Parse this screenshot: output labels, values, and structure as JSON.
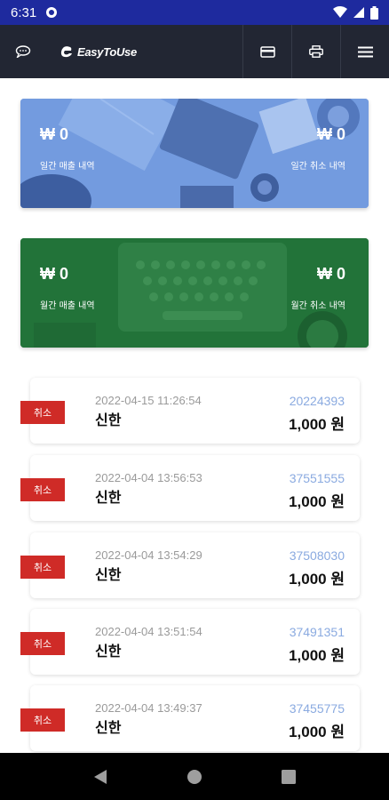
{
  "status_bar": {
    "time": "6:31"
  },
  "app_bar": {
    "brand": "EasyToUse"
  },
  "weekly_card": {
    "sales_amount": "₩ 0",
    "sales_label": "일간 매출 내역",
    "cancel_amount": "₩ 0",
    "cancel_label": "일간 취소 내역"
  },
  "monthly_card": {
    "sales_amount": "₩ 0",
    "sales_label": "월간 매출 내역",
    "cancel_amount": "₩ 0",
    "cancel_label": "월간 취소 내역"
  },
  "transactions": [
    {
      "badge": "취소",
      "datetime": "2022-04-15 11:26:54",
      "bank": "신한",
      "approval_no": "20224393",
      "amount": "1,000 원"
    },
    {
      "badge": "취소",
      "datetime": "2022-04-04 13:56:53",
      "bank": "신한",
      "approval_no": "37551555",
      "amount": "1,000 원"
    },
    {
      "badge": "취소",
      "datetime": "2022-04-04 13:54:29",
      "bank": "신한",
      "approval_no": "37508030",
      "amount": "1,000 원"
    },
    {
      "badge": "취소",
      "datetime": "2022-04-04 13:51:54",
      "bank": "신한",
      "approval_no": "37491351",
      "amount": "1,000 원"
    },
    {
      "badge": "취소",
      "datetime": "2022-04-04 13:49:37",
      "bank": "신한",
      "approval_no": "37455775",
      "amount": "1,000 원"
    }
  ],
  "colors": {
    "status_bar": "#1e2a9e",
    "app_bar": "#222633",
    "weekly_card": "#6f98de",
    "monthly_card": "#217239",
    "cancel_badge": "#cf2b27",
    "approval_no": "#8aaae0"
  },
  "icons": [
    "chat-icon",
    "card-icon",
    "printer-icon",
    "menu-icon",
    "wifi-icon",
    "signal-icon",
    "battery-icon",
    "back-icon",
    "home-icon",
    "recents-icon"
  ]
}
